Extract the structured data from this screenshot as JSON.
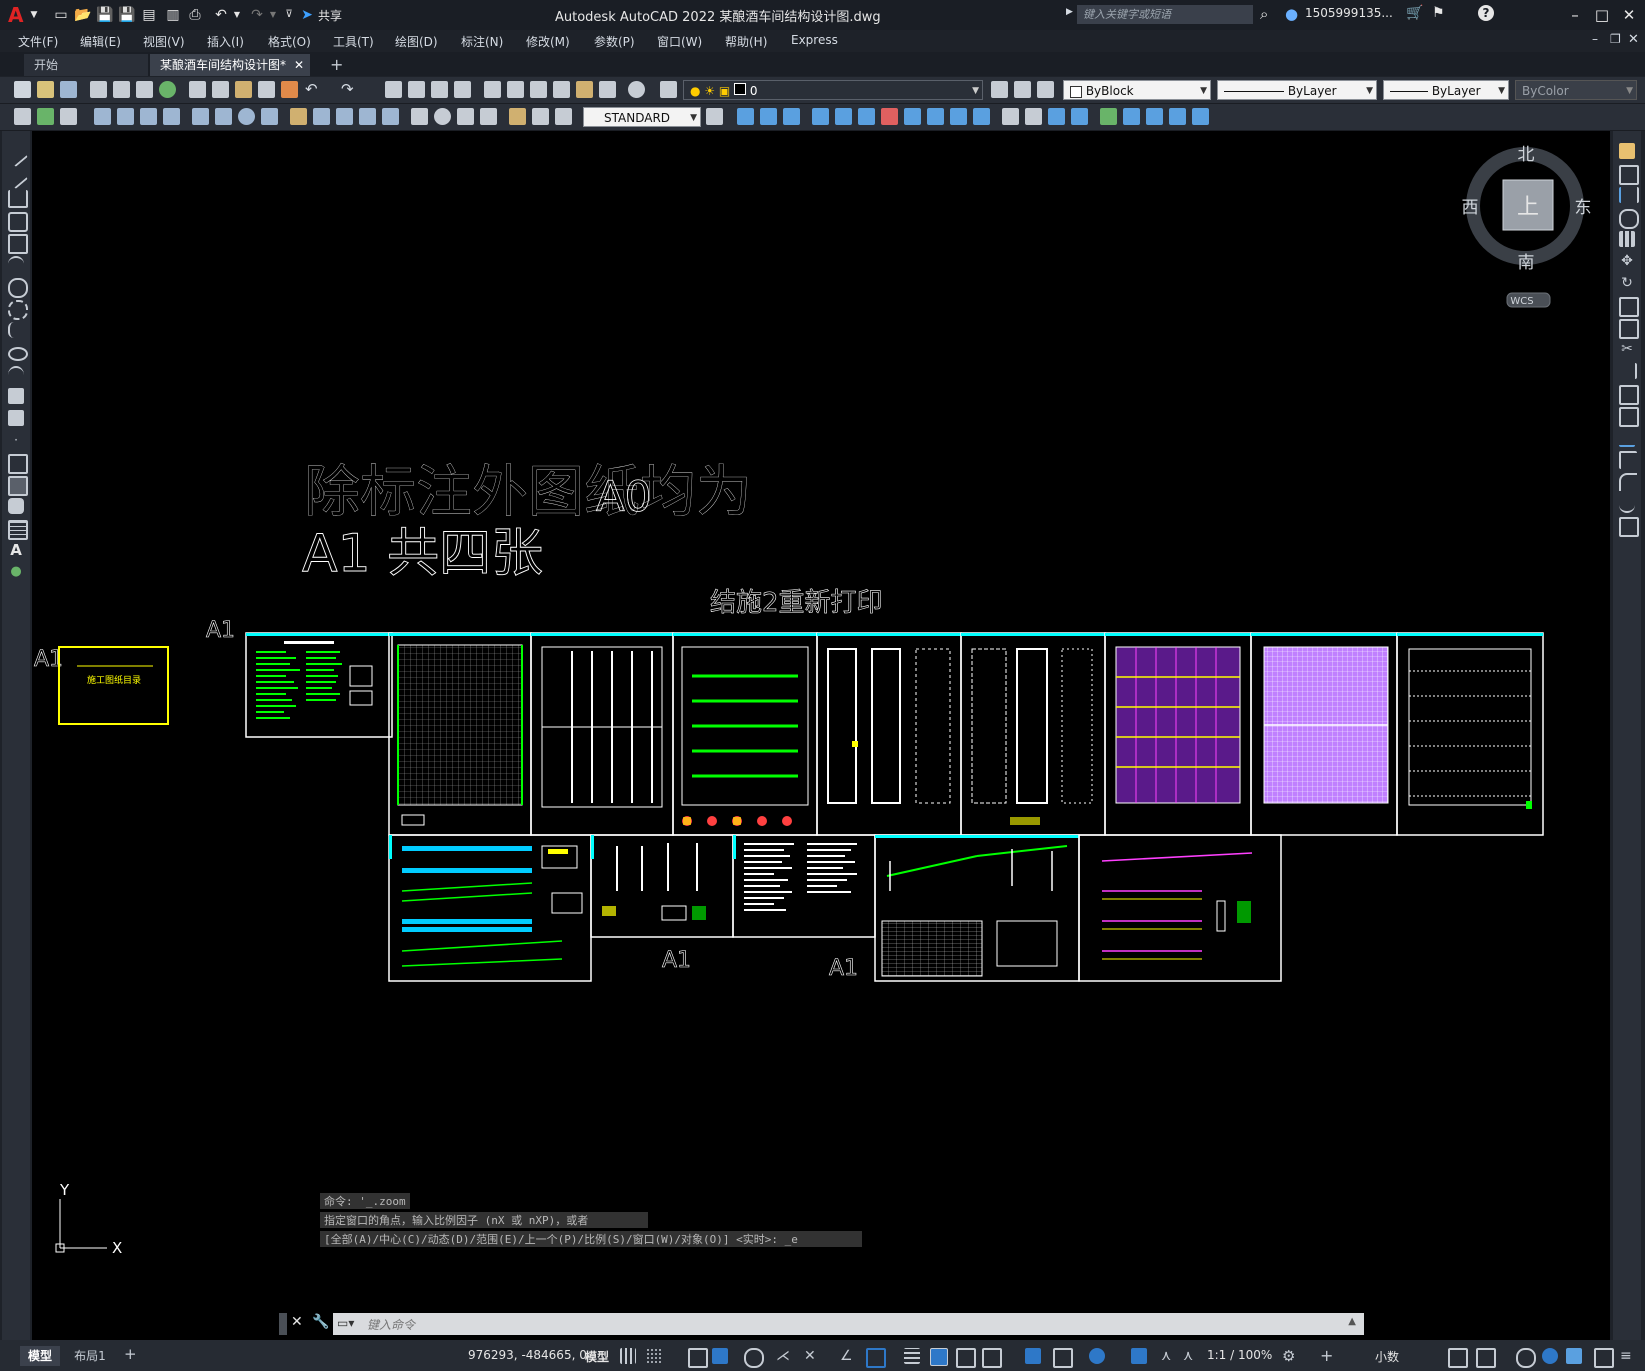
{
  "app": {
    "logo": "A",
    "title": "Autodesk AutoCAD 2022    某酿酒车间结构设计图.dwg",
    "search_placeholder": "键入关键字或短语",
    "user": "1505999135...",
    "share_label": "共享"
  },
  "menu": [
    "文件(F)",
    "编辑(E)",
    "视图(V)",
    "插入(I)",
    "格式(O)",
    "工具(T)",
    "绘图(D)",
    "标注(N)",
    "修改(M)",
    "参数(P)",
    "窗口(W)",
    "帮助(H)",
    "Express"
  ],
  "tabs": [
    {
      "label": "开始"
    },
    {
      "label": "某酿酒车间结构设计图*"
    }
  ],
  "layer": {
    "name": "0"
  },
  "properties": {
    "color": "ByBlock",
    "linetype": "ByLayer",
    "lineweight": "ByLayer",
    "plotstyle": "ByColor"
  },
  "textstyle": "STANDARD",
  "viewcube": {
    "north": "北",
    "south": "南",
    "east": "东",
    "west": "西",
    "top": "上",
    "wcs": "WCS"
  },
  "drawing_text": {
    "note_line1": "除标注外图纸均为",
    "note_overlap": "A0",
    "note_line2": "A1 共四张",
    "reprint": "结施2重新打印",
    "a1_left": "A1",
    "a1_top": "A1",
    "a1_bottom1": "A1",
    "a1_bottom2": "A1",
    "cover_title": "施工图纸目录"
  },
  "ucs": {
    "x": "X",
    "y": "Y"
  },
  "command": {
    "history": [
      "命令: '_.zoom",
      "指定窗口的角点，输入比例因子 (nX 或 nXP)，或者",
      "[全部(A)/中心(C)/动态(D)/范围(E)/上一个(P)/比例(S)/窗口(W)/对象(O)] <实时>: _e"
    ],
    "placeholder": "键入命令"
  },
  "layout_tabs": [
    "模型",
    "布局1"
  ],
  "status": {
    "coords": "976293, -484665, 0",
    "space": "模型",
    "scale": "1:1 / 100%",
    "units": "小数"
  },
  "colors": {
    "canvas": "#000000",
    "chrome": "#2a2f38",
    "sheet_border": "#ffffff",
    "cover_border": "#ffff00",
    "sheet_top_edge": "#00ffff"
  }
}
